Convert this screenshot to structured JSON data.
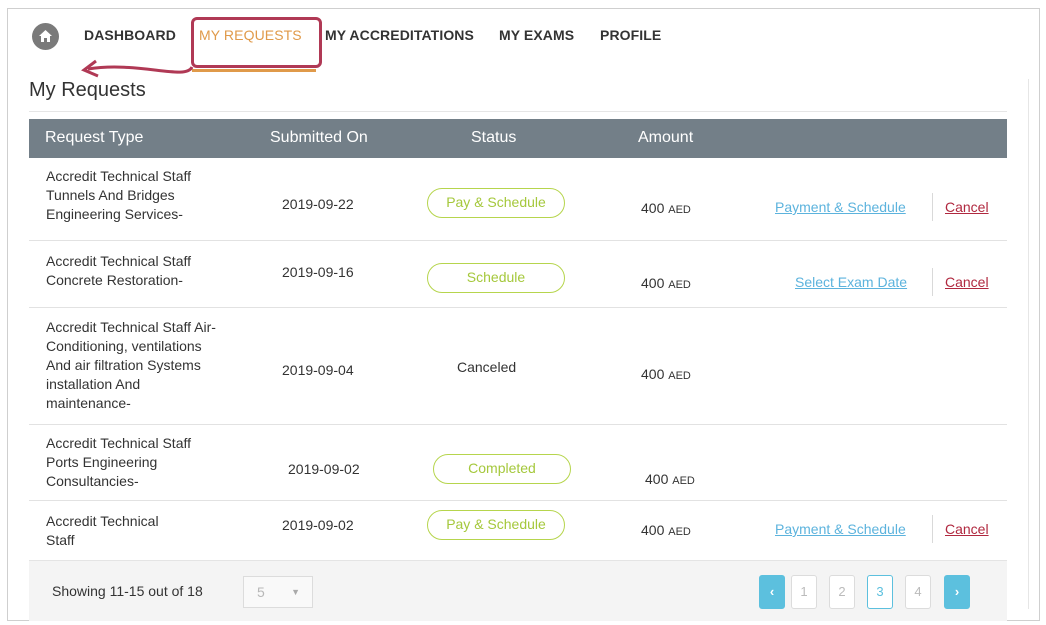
{
  "nav": {
    "items": [
      "DASHBOARD",
      "MY REQUESTS",
      "MY ACCREDITATIONS",
      "MY EXAMS",
      "PROFILE"
    ],
    "active": "MY REQUESTS"
  },
  "page": {
    "title": "My Requests"
  },
  "table": {
    "headers": [
      "Request Type",
      "Submitted On",
      "Status",
      "Amount"
    ],
    "rows": [
      {
        "type": [
          "Accredit Technical Staff",
          "Tunnels And Bridges",
          "Engineering Services-"
        ],
        "date": "2019-09-22",
        "status": "Pay & Schedule",
        "amount": "400",
        "currency": "AED",
        "action": "Payment & Schedule",
        "cancel": "Cancel"
      },
      {
        "type": [
          "Accredit Technical Staff",
          "Concrete Restoration-"
        ],
        "date": "2019-09-16",
        "status": "Schedule",
        "amount": "400",
        "currency": "AED",
        "action": "Select Exam Date",
        "cancel": "Cancel"
      },
      {
        "type": [
          "Accredit Technical Staff Air-",
          "Conditioning, ventilations",
          "And air filtration Systems",
          "installation  And",
          "maintenance-"
        ],
        "date": "2019-09-04",
        "status": "Canceled",
        "amount": "400",
        "currency": "AED",
        "action": "",
        "cancel": ""
      },
      {
        "type": [
          "Accredit Technical Staff",
          "Ports Engineering",
          "Consultancies-"
        ],
        "date": "2019-09-02",
        "status": "Completed",
        "amount": "400",
        "currency": "AED",
        "action": "",
        "cancel": ""
      },
      {
        "type": [
          "Accredit Technical",
          "Staff"
        ],
        "date": "2019-09-02",
        "status": "Pay & Schedule",
        "amount": "400",
        "currency": "AED",
        "action": "Payment & Schedule",
        "cancel": "Cancel"
      }
    ]
  },
  "footer": {
    "showing": "Showing 11-15 out of 18",
    "page_size": "5",
    "prev": "‹",
    "next": "›",
    "pages": [
      "1",
      "2",
      "3",
      "4"
    ],
    "current_page": "3"
  },
  "colors": {
    "header_bg": "#737f88",
    "active_nav": "#e09a4a",
    "annotation": "#b03955",
    "pill_border": "#b6d54d",
    "link": "#5cb3dd",
    "cancel": "#b0283f",
    "pagination": "#5cc0de"
  }
}
